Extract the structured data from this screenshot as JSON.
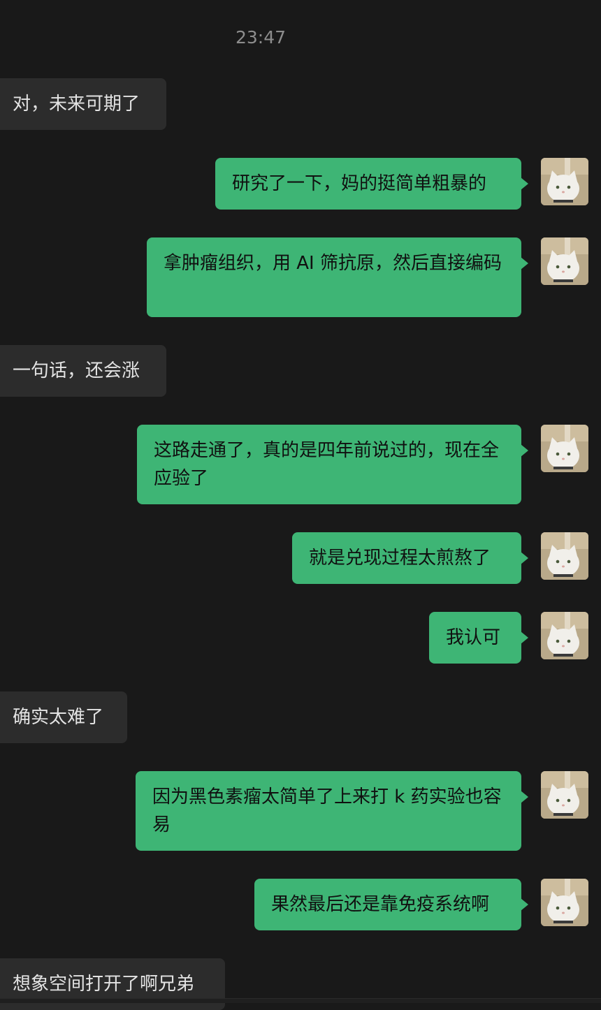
{
  "chat": {
    "timestamp": "23:47",
    "messages": [
      {
        "side": "in",
        "text": "对，未来可期了"
      },
      {
        "side": "out",
        "text": "研究了一下，妈的挺简单粗暴的"
      },
      {
        "side": "out",
        "text": "拿肿瘤组织，用 AI 筛抗原，然后直接编码"
      },
      {
        "side": "in",
        "text": "一句话，还会涨"
      },
      {
        "side": "out",
        "text": "这路走通了，真的是四年前说过的，现在全应验了"
      },
      {
        "side": "out",
        "text": "就是兑现过程太煎熬了"
      },
      {
        "side": "out",
        "text": "我认可"
      },
      {
        "side": "in",
        "text": "确实太难了"
      },
      {
        "side": "out",
        "text": "因为黑色素瘤太简单了上来打 k 药实验也容易"
      },
      {
        "side": "out",
        "text": "果然最后还是靠免疫系统啊"
      },
      {
        "side": "in",
        "text": "想象空间打开了啊兄弟"
      }
    ]
  },
  "avatar": {
    "icon": "cat-avatar-icon"
  },
  "colors": {
    "background": "#191919",
    "outgoing_bubble": "#3eb575",
    "incoming_bubble": "#2c2c2c",
    "timestamp_text": "#8d8d8d"
  }
}
